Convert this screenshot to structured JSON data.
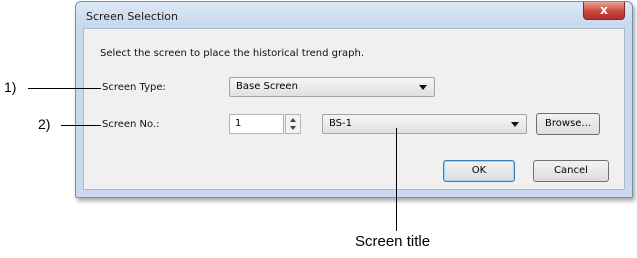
{
  "dialog": {
    "title": "Screen Selection",
    "close_glyph": "x",
    "instruction": "Select the screen to place the historical trend graph.",
    "screen_type": {
      "label": "Screen Type:",
      "value": "Base Screen"
    },
    "screen_no": {
      "label": "Screen No.:",
      "number": "1",
      "title_value": "BS-1"
    },
    "browse_label": "Browse...",
    "ok_label": "OK",
    "cancel_label": "Cancel"
  },
  "annotations": {
    "callout_1": "1)",
    "callout_2": "2)",
    "screen_title": "Screen title"
  }
}
